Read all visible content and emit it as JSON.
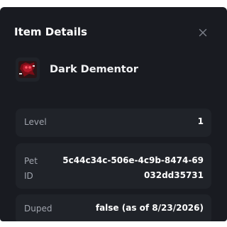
{
  "modal": {
    "title": "Item Details",
    "close_icon": "close-icon"
  },
  "item": {
    "name": "Dark Dementor",
    "thumbnail_icon": "pet-thumbnail"
  },
  "details": [
    {
      "label": "Level",
      "value": "1"
    },
    {
      "label": "Pet ID",
      "value": "5c44c34c-506e-4c9b-8474-69032dd35731"
    },
    {
      "label": "Duped",
      "value": "false (as of 8/23/2026)"
    }
  ],
  "colors": {
    "modal_bg": "#191b21",
    "row_bg": "#202329",
    "label": "#a0a4ad",
    "value": "#ffffff"
  }
}
